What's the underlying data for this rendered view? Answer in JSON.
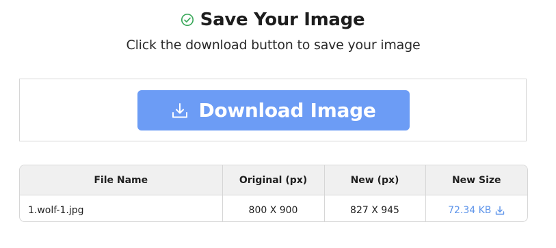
{
  "header": {
    "title": "Save Your Image",
    "subtitle": "Click the download button to save your image",
    "check_icon": "check-circle-icon",
    "accent_color": "#3aa85a"
  },
  "download": {
    "label": "Download Image",
    "icon": "download-icon",
    "button_color": "#6c9cf5"
  },
  "table": {
    "columns": [
      "File Name",
      "Original (px)",
      "New (px)",
      "New Size"
    ],
    "rows": [
      {
        "file_name": "1.wolf-1.jpg",
        "original": "800 X 900",
        "new": "827 X 945",
        "new_size": "72.34 KB",
        "size_icon": "download-icon"
      }
    ],
    "link_color": "#5f95ea"
  }
}
